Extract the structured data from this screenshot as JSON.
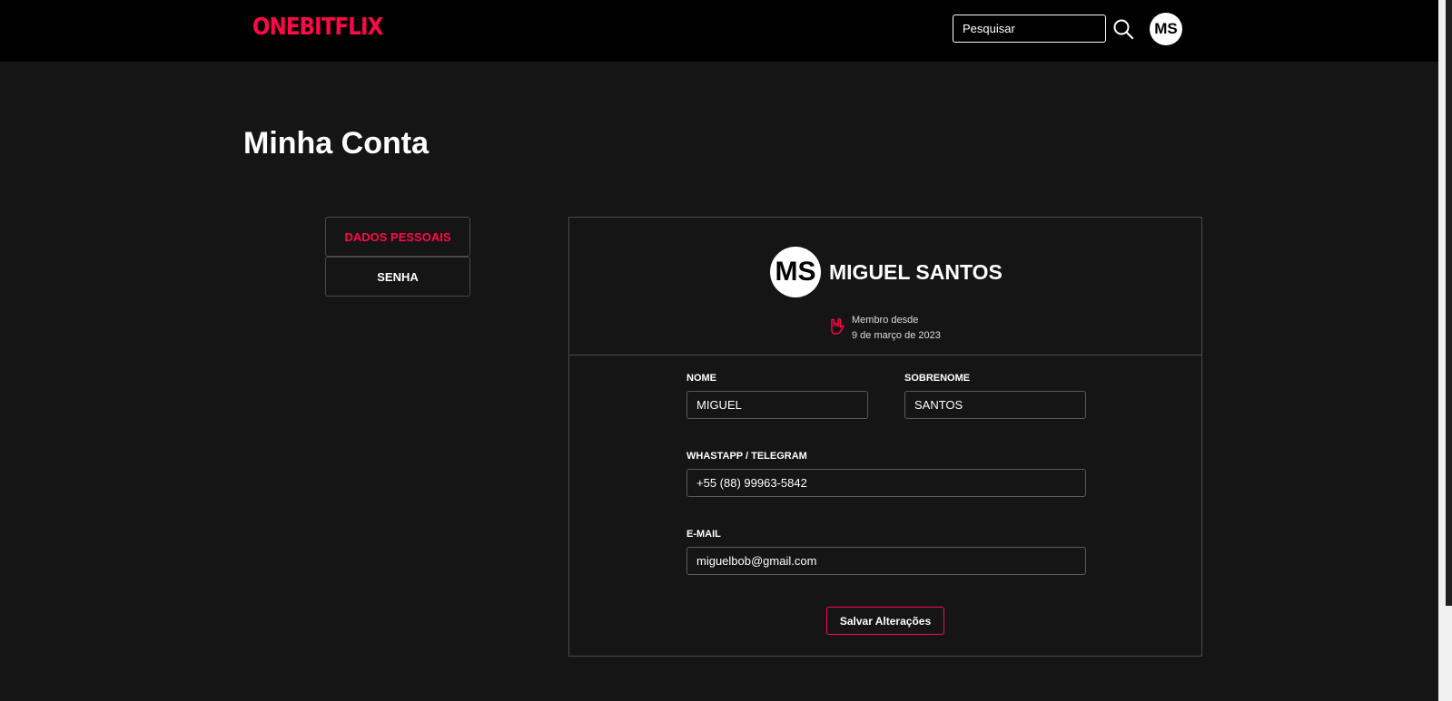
{
  "header": {
    "logo": "ONEBITFLIX",
    "search_placeholder": "Pesquisar",
    "avatar_initials": "MS"
  },
  "page": {
    "title": "Minha Conta"
  },
  "tabs": [
    {
      "label": "DADOS PESSOAIS",
      "active": true
    },
    {
      "label": "SENHA",
      "active": false
    }
  ],
  "profile": {
    "initials": "MS",
    "name": "MIGUEL SANTOS",
    "member_since_label": "Membro desde",
    "member_since_date": "9 de março de 2023"
  },
  "form": {
    "first_name_label": "NOME",
    "first_name_value": "MIGUEL",
    "last_name_label": "SOBRENOME",
    "last_name_value": "SANTOS",
    "phone_label": "WHASTAPP / TELEGRAM",
    "phone_value": "+55 (88) 99963-5842",
    "email_label": "E-MAIL",
    "email_value": "miguelbob@gmail.com",
    "save_label": "Salvar Alterações"
  },
  "colors": {
    "accent": "#ff0a47",
    "background": "#151515",
    "header_background": "#000000"
  }
}
